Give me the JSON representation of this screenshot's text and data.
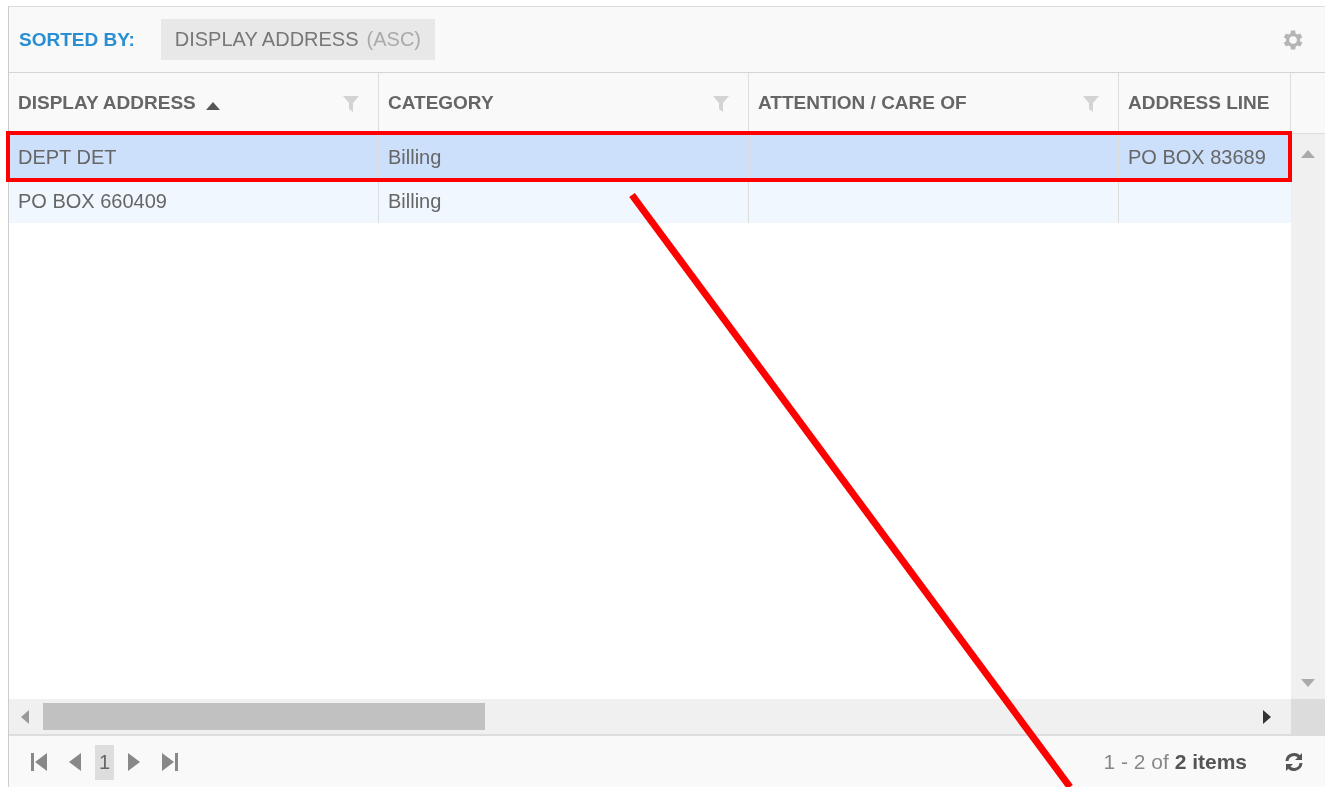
{
  "toolbar": {
    "sorted_by_label": "SORTED BY:",
    "sort_chip": {
      "field": "DISPLAY ADDRESS",
      "direction": "(ASC)"
    }
  },
  "table": {
    "columns": [
      {
        "label": "DISPLAY ADDRESS",
        "sorted": true,
        "filter": true
      },
      {
        "label": "CATEGORY",
        "sorted": false,
        "filter": true
      },
      {
        "label": "ATTENTION / CARE OF",
        "sorted": false,
        "filter": true
      },
      {
        "label": "ADDRESS LINE",
        "sorted": false,
        "filter": false
      }
    ],
    "rows": [
      {
        "selected": true,
        "cells": [
          "DEPT DET",
          "Billing",
          "",
          "PO BOX 83689"
        ]
      },
      {
        "selected": false,
        "cells": [
          "PO BOX 660409",
          "Billing",
          "",
          ""
        ]
      }
    ]
  },
  "pager": {
    "pages": [
      {
        "label": "1",
        "selected": true
      }
    ],
    "summary": "1 - 2 of **2 items**"
  }
}
